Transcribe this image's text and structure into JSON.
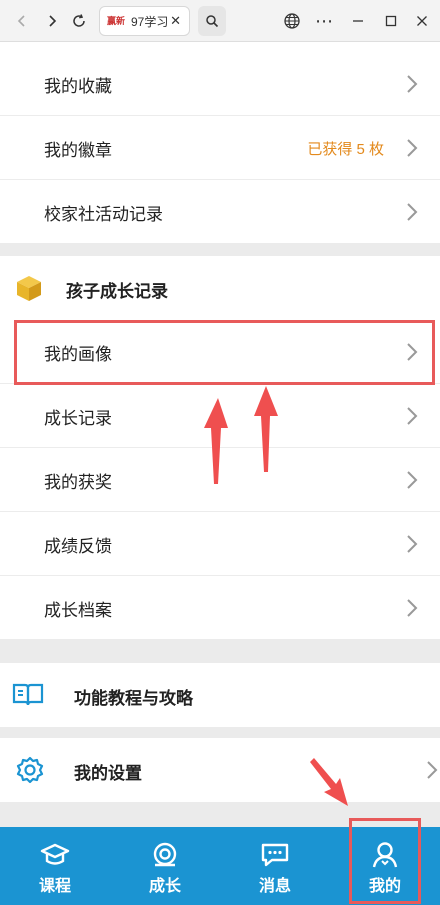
{
  "browser": {
    "tab_title": "97学习",
    "tab_logo": "赢新"
  },
  "menu": {
    "favorites": "我的收藏",
    "badges": "我的徽章",
    "badges_extra": "已获得 5 枚",
    "activity": "校家社活动记录"
  },
  "growth_section": {
    "title": "孩子成长记录",
    "items": [
      "我的画像",
      "成长记录",
      "我的获奖",
      "成绩反馈",
      "成长档案"
    ]
  },
  "tutorial": {
    "title": "功能教程与攻略"
  },
  "settings": {
    "title": "我的设置"
  },
  "tabbar": {
    "items": [
      {
        "label": "课程",
        "icon": "graduation-cap-icon"
      },
      {
        "label": "成长",
        "icon": "growth-icon"
      },
      {
        "label": "消息",
        "icon": "message-icon"
      },
      {
        "label": "我的",
        "icon": "user-icon"
      }
    ]
  },
  "colors": {
    "tabbar_bg": "#1b94d2",
    "accent_orange": "#e38a1d",
    "annotation_red": "#e85a5a",
    "section_icon_yellow": "#e8b52a"
  }
}
